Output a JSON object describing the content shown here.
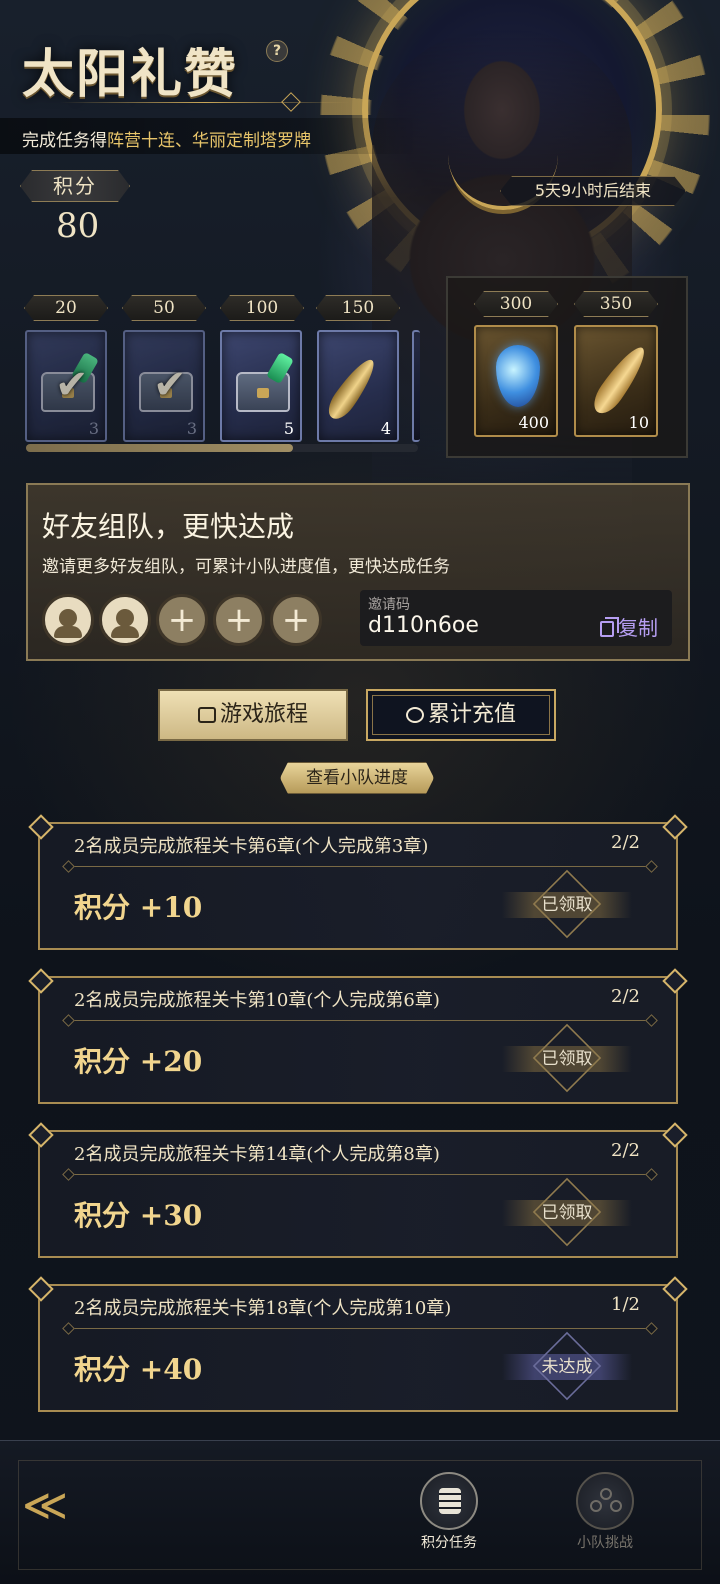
{
  "header": {
    "title": "太阳礼赞",
    "help_icon": "?",
    "subtitle_prefix": "完成任务得",
    "subtitle_highlight": "阵营十连、华丽定制塔罗牌",
    "points_label": "积分",
    "points_value": "80",
    "countdown": "5天9小时后结束"
  },
  "rewards": {
    "tiers": [
      {
        "threshold": "20",
        "quantity": "3",
        "icon": "chest-icon",
        "claimed": true
      },
      {
        "threshold": "50",
        "quantity": "3",
        "icon": "chest-icon",
        "claimed": true
      },
      {
        "threshold": "100",
        "quantity": "5",
        "icon": "chest-icon",
        "claimed": false
      },
      {
        "threshold": "150",
        "quantity": "4",
        "icon": "feather-icon",
        "claimed": false
      }
    ],
    "bonus": [
      {
        "threshold": "300",
        "quantity": "400",
        "icon": "crystal-icon"
      },
      {
        "threshold": "350",
        "quantity": "10",
        "icon": "gold-feather-icon"
      }
    ],
    "progress_fraction": 0.68
  },
  "team": {
    "title": "好友组队，更快达成",
    "description": "邀请更多好友组队，可累计小队进度值，更快达成任务",
    "slots": [
      "filled",
      "filled",
      "empty",
      "empty",
      "empty"
    ],
    "invite_label": "邀请码",
    "invite_code": "d110n6oe",
    "copy_label": "复制"
  },
  "tabs": {
    "journey": "游戏旅程",
    "recharge": "累计充值"
  },
  "view_progress": "查看小队进度",
  "tasks": [
    {
      "title": "2名成员完成旅程关卡第6章(个人完成第3章)",
      "count": "2/2",
      "reward": "积分 +10",
      "status": "已领取"
    },
    {
      "title": "2名成员完成旅程关卡第10章(个人完成第6章)",
      "count": "2/2",
      "reward": "积分 +20",
      "status": "已领取"
    },
    {
      "title": "2名成员完成旅程关卡第14章(个人完成第8章)",
      "count": "2/2",
      "reward": "积分 +30",
      "status": "已领取"
    },
    {
      "title": "2名成员完成旅程关卡第18章(个人完成第10章)",
      "count": "1/2",
      "reward": "积分 +40",
      "status": "未达成"
    }
  ],
  "bottom_nav": {
    "back_icon": "back-arrow-icon",
    "items": [
      {
        "label": "积分任务",
        "icon": "coin-stack-icon",
        "active": true
      },
      {
        "label": "小队挑战",
        "icon": "team-icon",
        "active": false
      }
    ]
  }
}
